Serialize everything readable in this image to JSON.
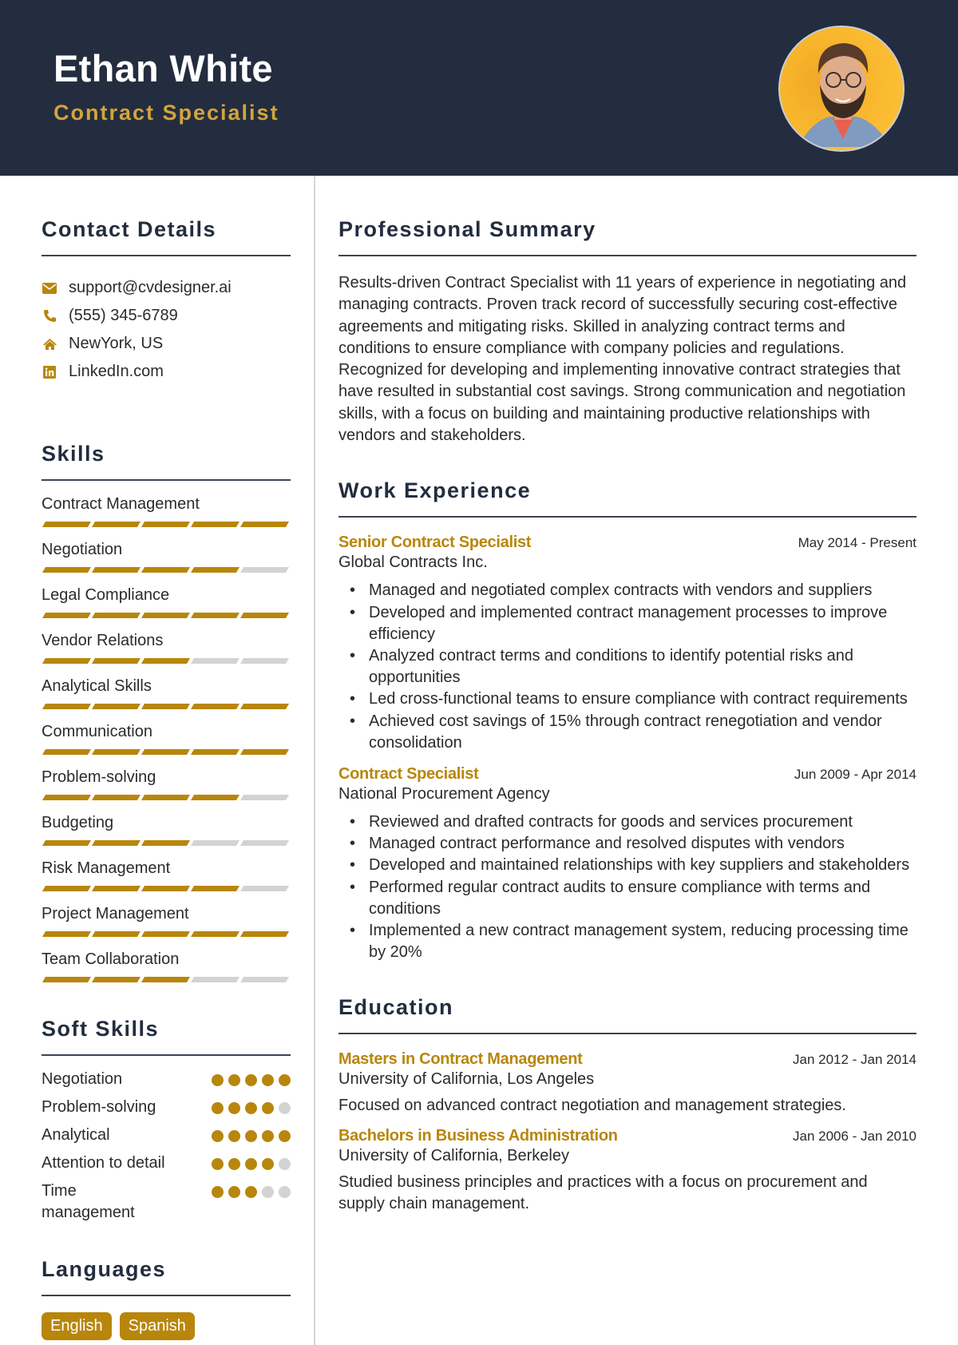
{
  "header": {
    "name": "Ethan White",
    "title": "Contract Specialist",
    "photo_alt": "Profile photo"
  },
  "colors": {
    "header_bg": "#232d3f",
    "accent": "#b8860b",
    "title_gold": "#d4a43b",
    "inactive": "#d3d3d3"
  },
  "contact": {
    "heading": "Contact Details",
    "items": [
      {
        "icon": "envelope-icon",
        "text": "support@cvdesigner.ai"
      },
      {
        "icon": "phone-icon",
        "text": "(555) 345-6789"
      },
      {
        "icon": "home-icon",
        "text": "NewYork, US"
      },
      {
        "icon": "linkedin-icon",
        "text": "LinkedIn.com"
      }
    ]
  },
  "skills": {
    "heading": "Skills",
    "max": 5,
    "items": [
      {
        "name": "Contract Management",
        "level": 5
      },
      {
        "name": "Negotiation",
        "level": 4
      },
      {
        "name": "Legal Compliance",
        "level": 5
      },
      {
        "name": "Vendor Relations",
        "level": 3
      },
      {
        "name": "Analytical Skills",
        "level": 5
      },
      {
        "name": "Communication",
        "level": 5
      },
      {
        "name": "Problem-solving",
        "level": 4
      },
      {
        "name": "Budgeting",
        "level": 3
      },
      {
        "name": "Risk Management",
        "level": 4
      },
      {
        "name": "Project Management",
        "level": 5
      },
      {
        "name": "Team Collaboration",
        "level": 3
      }
    ]
  },
  "soft_skills": {
    "heading": "Soft Skills",
    "max": 5,
    "items": [
      {
        "name": "Negotiation",
        "level": 5
      },
      {
        "name": "Problem-solving",
        "level": 4
      },
      {
        "name": "Analytical",
        "level": 5
      },
      {
        "name": "Attention to detail",
        "level": 4
      },
      {
        "name": "Time management",
        "level": 3
      }
    ]
  },
  "languages": {
    "heading": "Languages",
    "items": [
      "English",
      "Spanish"
    ]
  },
  "summary": {
    "heading": "Professional Summary",
    "text": "Results-driven Contract Specialist with 11 years of experience in negotiating and managing contracts. Proven track record of successfully securing cost-effective agreements and mitigating risks. Skilled in analyzing contract terms and conditions to ensure compliance with company policies and regulations. Recognized for developing and implementing innovative contract strategies that have resulted in substantial cost savings. Strong communication and negotiation skills, with a focus on building and maintaining productive relationships with vendors and stakeholders."
  },
  "experience": {
    "heading": "Work Experience",
    "jobs": [
      {
        "title": "Senior Contract Specialist",
        "dates": "May 2014 - Present",
        "org": "Global Contracts Inc.",
        "bullets": [
          "Managed and negotiated complex contracts with vendors and suppliers",
          "Developed and implemented contract management processes to improve efficiency",
          "Analyzed contract terms and conditions to identify potential risks and opportunities",
          "Led cross-functional teams to ensure compliance with contract requirements",
          "Achieved cost savings of 15% through contract renegotiation and vendor consolidation"
        ]
      },
      {
        "title": "Contract Specialist",
        "dates": "Jun 2009 - Apr 2014",
        "org": "National Procurement Agency",
        "bullets": [
          "Reviewed and drafted contracts for goods and services procurement",
          "Managed contract performance and resolved disputes with vendors",
          "Developed and maintained relationships with key suppliers and stakeholders",
          "Performed regular contract audits to ensure compliance with terms and conditions",
          "Implemented a new contract management system, reducing processing time by 20%"
        ]
      }
    ]
  },
  "education": {
    "heading": "Education",
    "items": [
      {
        "degree": "Masters in Contract Management",
        "dates": "Jan 2012 - Jan 2014",
        "school": "University of California, Los Angeles",
        "desc": "Focused on advanced contract negotiation and management strategies."
      },
      {
        "degree": "Bachelors in Business Administration",
        "dates": "Jan 2006 - Jan 2010",
        "school": "University of California, Berkeley",
        "desc": "Studied business principles and practices with a focus on procurement and supply chain management."
      }
    ]
  }
}
